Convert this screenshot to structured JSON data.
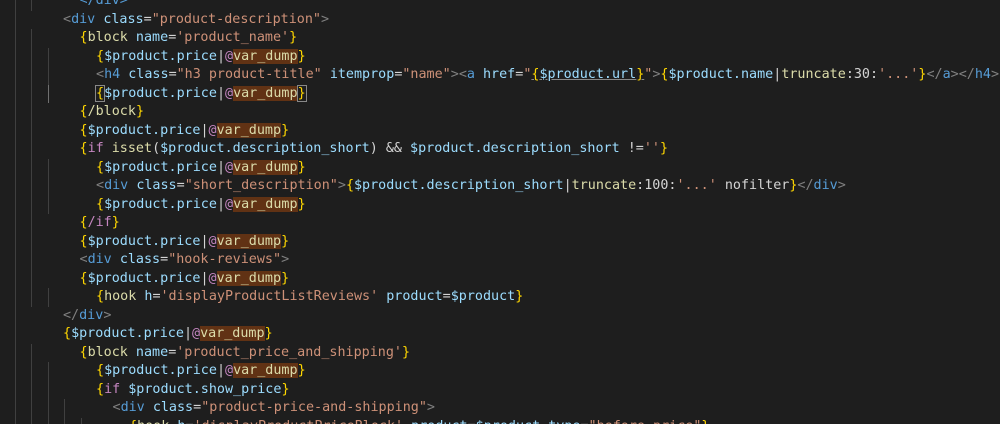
{
  "colors": {
    "background": "#1e1e1e",
    "tag": "#569cd6",
    "attribute": "#9cdcfe",
    "string": "#ce9178",
    "punctuation": "#808080",
    "brace": "#ffd700",
    "variable": "#9cdcfe",
    "text": "#d4d4d4",
    "function": "#dcdcaa",
    "control": "#c586c0",
    "find_highlight": "#613214"
  },
  "editor": {
    "lines": [
      {
        "indent": 3,
        "tokens": [
          {
            "t": "</div>",
            "c": "tag"
          }
        ]
      },
      {
        "indent": 2,
        "tokens": [
          {
            "t": "<",
            "c": "pun"
          },
          {
            "t": "div",
            "c": "tag"
          },
          {
            "t": " "
          },
          {
            "t": "class",
            "c": "attr"
          },
          {
            "t": "=",
            "c": "txt"
          },
          {
            "t": "\"product-description\"",
            "c": "str"
          },
          {
            "t": ">",
            "c": "pun"
          }
        ]
      },
      {
        "indent": 3,
        "tokens": [
          {
            "t": "{",
            "c": "brace"
          },
          {
            "t": "block",
            "c": "fn"
          },
          {
            "t": " name",
            "c": "attr"
          },
          {
            "t": "=",
            "c": "txt"
          },
          {
            "t": "'product_name'",
            "c": "str"
          },
          {
            "t": "}",
            "c": "brace"
          }
        ]
      },
      {
        "indent": 4,
        "tokens": [
          {
            "t": "{",
            "c": "brace"
          },
          {
            "t": "$product.price",
            "c": "var"
          },
          {
            "t": "|",
            "c": "txt"
          },
          {
            "t": "@",
            "c": "ctl"
          },
          {
            "t": "var_dump",
            "c": "fn",
            "hl": true
          },
          {
            "t": "}",
            "c": "brace"
          }
        ]
      },
      {
        "indent": 4,
        "tokens": [
          {
            "t": "<",
            "c": "pun"
          },
          {
            "t": "h4",
            "c": "tag"
          },
          {
            "t": " "
          },
          {
            "t": "class",
            "c": "attr"
          },
          {
            "t": "=",
            "c": "txt"
          },
          {
            "t": "\"h3 product-title\"",
            "c": "str"
          },
          {
            "t": " "
          },
          {
            "t": "itemprop",
            "c": "attr"
          },
          {
            "t": "=",
            "c": "txt"
          },
          {
            "t": "\"name\"",
            "c": "str"
          },
          {
            "t": ">",
            "c": "pun"
          },
          {
            "t": "<",
            "c": "pun"
          },
          {
            "t": "a",
            "c": "tag"
          },
          {
            "t": " "
          },
          {
            "t": "href",
            "c": "attr"
          },
          {
            "t": "=",
            "c": "txt"
          },
          {
            "t": "\"",
            "c": "str"
          },
          {
            "t": "{",
            "c": "brace",
            "ul": true
          },
          {
            "t": "$product.url",
            "c": "var",
            "ul": true
          },
          {
            "t": "}",
            "c": "brace",
            "ul": true
          },
          {
            "t": "\"",
            "c": "str"
          },
          {
            "t": ">",
            "c": "pun"
          },
          {
            "t": "{",
            "c": "brace"
          },
          {
            "t": "$product.name",
            "c": "var"
          },
          {
            "t": "|",
            "c": "txt"
          },
          {
            "t": "truncate",
            "c": "fn"
          },
          {
            "t": ":30:",
            "c": "txt"
          },
          {
            "t": "'...'",
            "c": "str"
          },
          {
            "t": "}",
            "c": "brace"
          },
          {
            "t": "</",
            "c": "pun"
          },
          {
            "t": "a",
            "c": "tag"
          },
          {
            "t": ">",
            "c": "pun"
          },
          {
            "t": "</",
            "c": "pun"
          },
          {
            "t": "h4",
            "c": "tag"
          },
          {
            "t": ">",
            "c": "pun"
          }
        ]
      },
      {
        "indent": 4,
        "active": true,
        "tokens": [
          {
            "t": "{",
            "c": "brace",
            "bm": true
          },
          {
            "t": "$product.price",
            "c": "var"
          },
          {
            "t": "|",
            "c": "txt"
          },
          {
            "t": "@",
            "c": "ctl"
          },
          {
            "t": "var_dump",
            "c": "fn",
            "hl": true
          },
          {
            "t": "}",
            "c": "brace",
            "bm": true
          }
        ]
      },
      {
        "indent": 3,
        "tokens": [
          {
            "t": "{",
            "c": "brace"
          },
          {
            "t": "/block",
            "c": "fn"
          },
          {
            "t": "}",
            "c": "brace"
          }
        ]
      },
      {
        "indent": 3,
        "tokens": [
          {
            "t": "{",
            "c": "brace"
          },
          {
            "t": "$product.price",
            "c": "var"
          },
          {
            "t": "|",
            "c": "txt"
          },
          {
            "t": "@",
            "c": "ctl"
          },
          {
            "t": "var_dump",
            "c": "fn",
            "hl": true
          },
          {
            "t": "}",
            "c": "brace"
          }
        ]
      },
      {
        "indent": 3,
        "tokens": [
          {
            "t": "{",
            "c": "brace"
          },
          {
            "t": "if",
            "c": "ctl"
          },
          {
            "t": " "
          },
          {
            "t": "isset",
            "c": "fn"
          },
          {
            "t": "(",
            "c": "txt"
          },
          {
            "t": "$product.description_short",
            "c": "var"
          },
          {
            "t": ") && ",
            "c": "txt"
          },
          {
            "t": "$product.description_short",
            "c": "var"
          },
          {
            "t": " !=",
            "c": "txt"
          },
          {
            "t": "''",
            "c": "str"
          },
          {
            "t": "}",
            "c": "brace"
          }
        ]
      },
      {
        "indent": 4,
        "tokens": [
          {
            "t": "{",
            "c": "brace"
          },
          {
            "t": "$product.price",
            "c": "var"
          },
          {
            "t": "|",
            "c": "txt"
          },
          {
            "t": "@",
            "c": "ctl"
          },
          {
            "t": "var_dump",
            "c": "fn",
            "hl": true
          },
          {
            "t": "}",
            "c": "brace"
          }
        ]
      },
      {
        "indent": 4,
        "tokens": [
          {
            "t": "<",
            "c": "pun"
          },
          {
            "t": "div",
            "c": "tag"
          },
          {
            "t": " "
          },
          {
            "t": "class",
            "c": "attr"
          },
          {
            "t": "=",
            "c": "txt"
          },
          {
            "t": "\"short_description\"",
            "c": "str"
          },
          {
            "t": ">",
            "c": "pun"
          },
          {
            "t": "{",
            "c": "brace"
          },
          {
            "t": "$product.description_short",
            "c": "var"
          },
          {
            "t": "|",
            "c": "txt"
          },
          {
            "t": "truncate",
            "c": "fn"
          },
          {
            "t": ":100:",
            "c": "txt"
          },
          {
            "t": "'...'",
            "c": "str"
          },
          {
            "t": " nofilter",
            "c": "txt"
          },
          {
            "t": "}",
            "c": "brace"
          },
          {
            "t": "</",
            "c": "pun"
          },
          {
            "t": "div",
            "c": "tag"
          },
          {
            "t": ">",
            "c": "pun"
          }
        ]
      },
      {
        "indent": 4,
        "tokens": [
          {
            "t": "{",
            "c": "brace"
          },
          {
            "t": "$product.price",
            "c": "var"
          },
          {
            "t": "|",
            "c": "txt"
          },
          {
            "t": "@",
            "c": "ctl"
          },
          {
            "t": "var_dump",
            "c": "fn",
            "hl": true
          },
          {
            "t": "}",
            "c": "brace"
          }
        ]
      },
      {
        "indent": 3,
        "tokens": [
          {
            "t": "{",
            "c": "brace"
          },
          {
            "t": "/if",
            "c": "ctl"
          },
          {
            "t": "}",
            "c": "brace"
          }
        ]
      },
      {
        "indent": 3,
        "tokens": [
          {
            "t": "{",
            "c": "brace"
          },
          {
            "t": "$product.price",
            "c": "var"
          },
          {
            "t": "|",
            "c": "txt"
          },
          {
            "t": "@",
            "c": "ctl"
          },
          {
            "t": "var_dump",
            "c": "fn",
            "hl": true
          },
          {
            "t": "}",
            "c": "brace"
          }
        ]
      },
      {
        "indent": 3,
        "tokens": [
          {
            "t": "<",
            "c": "pun"
          },
          {
            "t": "div",
            "c": "tag"
          },
          {
            "t": " "
          },
          {
            "t": "class",
            "c": "attr"
          },
          {
            "t": "=",
            "c": "txt"
          },
          {
            "t": "\"hook-reviews\"",
            "c": "str"
          },
          {
            "t": ">",
            "c": "pun"
          }
        ]
      },
      {
        "indent": 3,
        "tokens": [
          {
            "t": "{",
            "c": "brace"
          },
          {
            "t": "$product.price",
            "c": "var"
          },
          {
            "t": "|",
            "c": "txt"
          },
          {
            "t": "@",
            "c": "ctl"
          },
          {
            "t": "var_dump",
            "c": "fn",
            "hl": true
          },
          {
            "t": "}",
            "c": "brace"
          }
        ]
      },
      {
        "indent": 4,
        "tokens": [
          {
            "t": "{",
            "c": "brace"
          },
          {
            "t": "hook",
            "c": "fn"
          },
          {
            "t": " h",
            "c": "attr"
          },
          {
            "t": "=",
            "c": "txt"
          },
          {
            "t": "'displayProductListReviews'",
            "c": "str"
          },
          {
            "t": " product",
            "c": "attr"
          },
          {
            "t": "=",
            "c": "txt"
          },
          {
            "t": "$product",
            "c": "var"
          },
          {
            "t": "}",
            "c": "brace"
          }
        ]
      },
      {
        "indent": 2,
        "tokens": [
          {
            "t": "</",
            "c": "pun"
          },
          {
            "t": "div",
            "c": "tag"
          },
          {
            "t": ">",
            "c": "pun"
          }
        ]
      },
      {
        "indent": 2,
        "tokens": [
          {
            "t": "{",
            "c": "brace"
          },
          {
            "t": "$product.price",
            "c": "var"
          },
          {
            "t": "|",
            "c": "txt"
          },
          {
            "t": "@",
            "c": "ctl"
          },
          {
            "t": "var_dump",
            "c": "fn",
            "hl": true
          },
          {
            "t": "}",
            "c": "brace"
          }
        ]
      },
      {
        "indent": 3,
        "tokens": [
          {
            "t": "{",
            "c": "brace"
          },
          {
            "t": "block",
            "c": "fn"
          },
          {
            "t": " name",
            "c": "attr"
          },
          {
            "t": "=",
            "c": "txt"
          },
          {
            "t": "'product_price_and_shipping'",
            "c": "str"
          },
          {
            "t": "}",
            "c": "brace"
          }
        ]
      },
      {
        "indent": 4,
        "tokens": [
          {
            "t": "{",
            "c": "brace"
          },
          {
            "t": "$product.price",
            "c": "var"
          },
          {
            "t": "|",
            "c": "txt"
          },
          {
            "t": "@",
            "c": "ctl"
          },
          {
            "t": "var_dump",
            "c": "fn",
            "hl": true
          },
          {
            "t": "}",
            "c": "brace"
          }
        ]
      },
      {
        "indent": 4,
        "tokens": [
          {
            "t": "{",
            "c": "brace"
          },
          {
            "t": "if",
            "c": "ctl"
          },
          {
            "t": " "
          },
          {
            "t": "$product.show_price",
            "c": "var"
          },
          {
            "t": "}",
            "c": "brace"
          }
        ]
      },
      {
        "indent": 5,
        "tokens": [
          {
            "t": "<",
            "c": "pun"
          },
          {
            "t": "div",
            "c": "tag"
          },
          {
            "t": " "
          },
          {
            "t": "class",
            "c": "attr"
          },
          {
            "t": "=",
            "c": "txt"
          },
          {
            "t": "\"product-price-and-shipping\"",
            "c": "str"
          },
          {
            "t": ">",
            "c": "pun"
          }
        ]
      },
      {
        "indent": 6,
        "tokens": [
          {
            "t": "{",
            "c": "brace"
          },
          {
            "t": "hook",
            "c": "fn"
          },
          {
            "t": " h",
            "c": "attr"
          },
          {
            "t": "=",
            "c": "txt"
          },
          {
            "t": "'displayProductPriceBlock'",
            "c": "str"
          },
          {
            "t": " product",
            "c": "attr"
          },
          {
            "t": "=",
            "c": "txt"
          },
          {
            "t": "$product",
            "c": "var"
          },
          {
            "t": " type",
            "c": "attr"
          },
          {
            "t": "=",
            "c": "txt"
          },
          {
            "t": "\"before_price\"",
            "c": "str"
          },
          {
            "t": "}",
            "c": "brace"
          }
        ]
      }
    ]
  }
}
